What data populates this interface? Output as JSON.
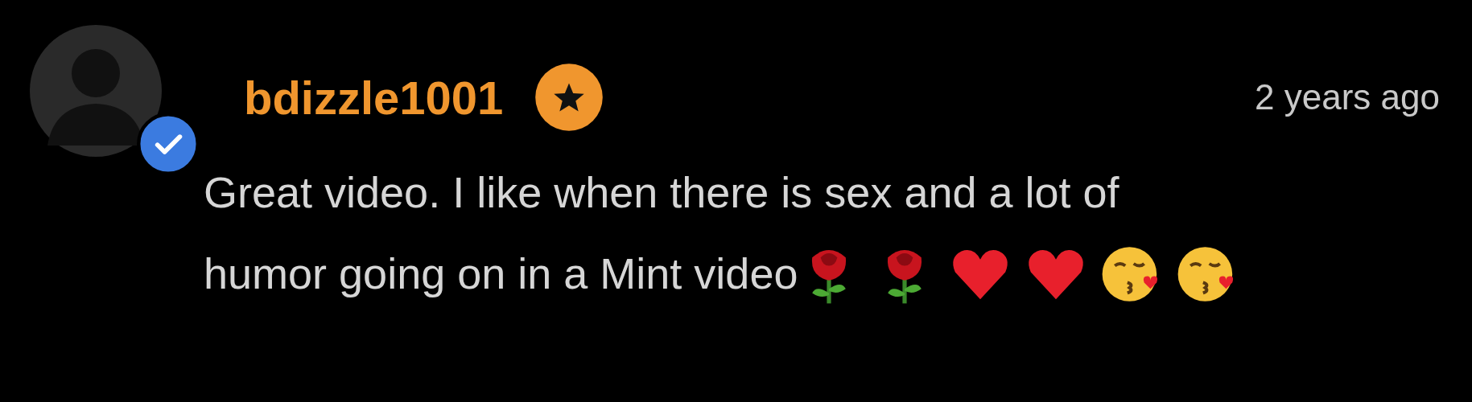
{
  "comment": {
    "username": "bdizzle1001",
    "verified": true,
    "starred": true,
    "time": "2 years ago",
    "text_lines": [
      "Great video. I like when there is sex and a lot of",
      "humor going on in a Mint video"
    ],
    "emojis": [
      {
        "kind": "rose"
      },
      {
        "kind": "rose"
      },
      {
        "kind": "heart"
      },
      {
        "kind": "heart"
      },
      {
        "kind": "kiss"
      },
      {
        "kind": "kiss"
      }
    ]
  }
}
